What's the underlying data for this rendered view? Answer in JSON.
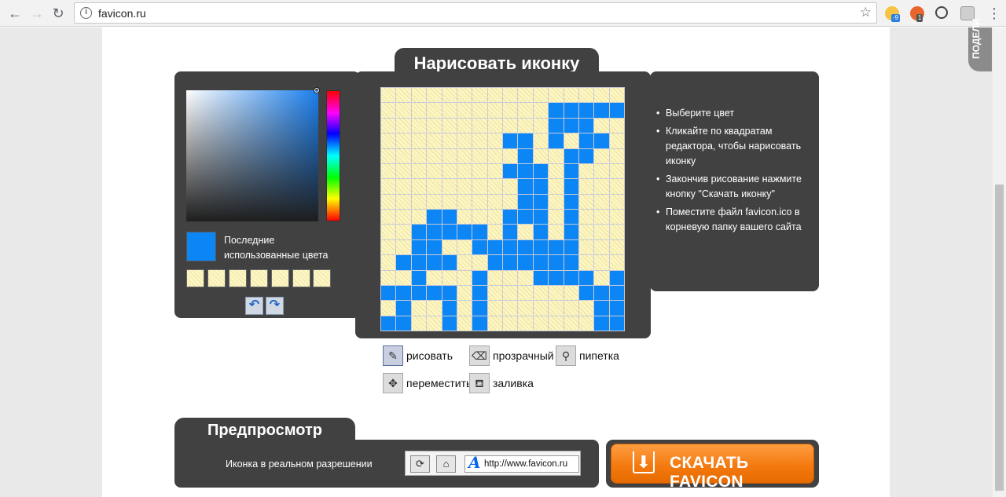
{
  "browser": {
    "url": "favicon.ru",
    "back_icon": "←",
    "forward_icon": "→",
    "reload_icon": "↻",
    "info_icon": "i",
    "star_icon": "☆",
    "weather_badge": "-9",
    "ext_badge": "1",
    "menu_icon": "⋮"
  },
  "share_tab": "ПОДЕЛИ",
  "editor": {
    "title": "Нарисовать иконку",
    "current_color": "#0c85f5",
    "recent_colors_label": "Последние использованные цвета",
    "undo_icon": "↶",
    "redo_icon": "↷",
    "grid": [
      "................",
      "...........#####",
      "...........###..",
      "........##.#.##.",
      ".........#..##..",
      "........###.#...",
      ".........##.#...",
      ".........##.#...",
      "...##...###.#...",
      "..#####.#.#.#...",
      "..##..#######...",
      ".####..######...",
      "..#...#...####.#",
      "#####.#......###",
      ".#..#.#.......##",
      "##..#.#.......##"
    ]
  },
  "tools": {
    "draw": {
      "label": "рисовать",
      "icon": "✎"
    },
    "transparent": {
      "label": "прозрачный",
      "icon": "⌫"
    },
    "eyedropper": {
      "label": "пипетка",
      "icon": "⚲"
    },
    "move": {
      "label": "переместить",
      "icon": "✥"
    },
    "fill": {
      "label": "заливка",
      "icon": "⛾"
    }
  },
  "instructions": [
    "Выберите цвет",
    "Кликайте по квадратам редактора, чтобы нарисовать иконку",
    "Закончив рисование нажмите кнопку \"Скачать иконку\"",
    "Поместите файл favicon.ico в корневую папку вашего сайта"
  ],
  "preview": {
    "title": "Предпросмотр",
    "label": "Иконка в реальном разрешении",
    "reload_icon": "⟳",
    "home_icon": "⌂",
    "url": "http://www.favicon.ru",
    "favicon_letter": "A"
  },
  "download": {
    "label": "СКАЧАТЬ FAVICON",
    "icon": "⬇"
  }
}
